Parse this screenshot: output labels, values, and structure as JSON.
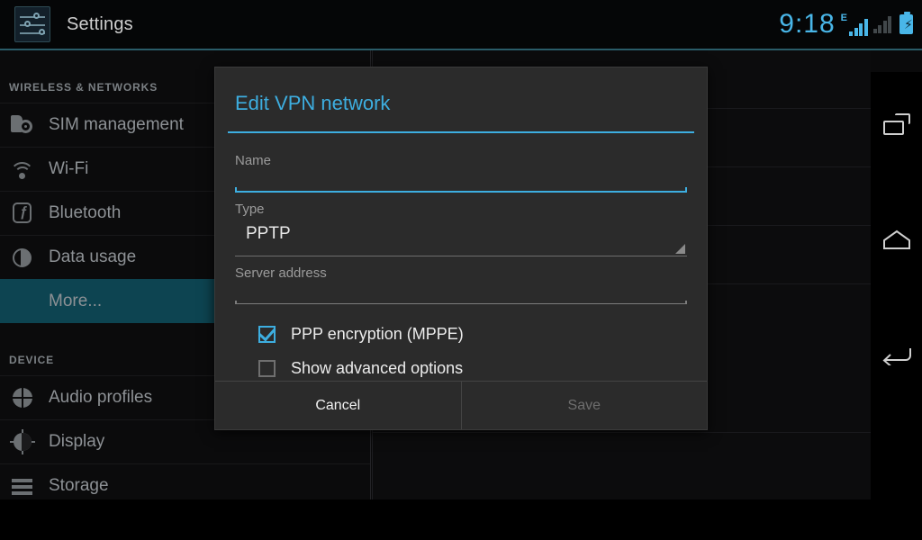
{
  "statusbar": {
    "clock": "9:18",
    "network_type_label": "E",
    "signal1_icon": "signal-bars-icon",
    "signal2_icon": "signal-bars-icon",
    "battery_icon": "battery-charging-icon",
    "battery_bolt": "⚡"
  },
  "actionbar": {
    "app_icon": "settings-sliders-icon",
    "title": "Settings"
  },
  "sidebar": {
    "sections": [
      {
        "header": "WIRELESS & NETWORKS",
        "items": [
          {
            "label": "SIM management",
            "icon": "sim-card-icon",
            "selected": false
          },
          {
            "label": "Wi-Fi",
            "icon": "wifi-icon",
            "selected": false
          },
          {
            "label": "Bluetooth",
            "icon": "bluetooth-icon",
            "selected": false
          },
          {
            "label": "Data usage",
            "icon": "data-usage-icon",
            "selected": false
          },
          {
            "label": "More...",
            "icon": "",
            "selected": true
          }
        ]
      },
      {
        "header": "DEVICE",
        "items": [
          {
            "label": "Audio profiles",
            "icon": "audio-profiles-icon",
            "selected": false
          },
          {
            "label": "Display",
            "icon": "display-brightness-icon",
            "selected": false
          },
          {
            "label": "Storage",
            "icon": "storage-icon",
            "selected": false
          }
        ]
      }
    ]
  },
  "dialog": {
    "title": "Edit VPN network",
    "fields": {
      "name": {
        "label": "Name",
        "value": "",
        "focused": true
      },
      "type": {
        "label": "Type",
        "value": "PPTP",
        "indicator": "chevron-down-icon"
      },
      "server_address": {
        "label": "Server address",
        "value": "",
        "focused": false
      }
    },
    "checkboxes": [
      {
        "label": "PPP encryption (MPPE)",
        "checked": true
      },
      {
        "label": "Show advanced options",
        "checked": false
      }
    ],
    "buttons": {
      "cancel": "Cancel",
      "save": "Save",
      "save_enabled": false
    }
  },
  "navbar": {
    "recents": "recents-icon",
    "home": "home-icon",
    "back": "back-icon"
  },
  "colors": {
    "accent_blue": "#3daee0",
    "status_blue": "#49b6e8",
    "selected_row": "#0d4451",
    "dialog_bg": "#2b2b2b",
    "screen_bg": "#000000"
  }
}
